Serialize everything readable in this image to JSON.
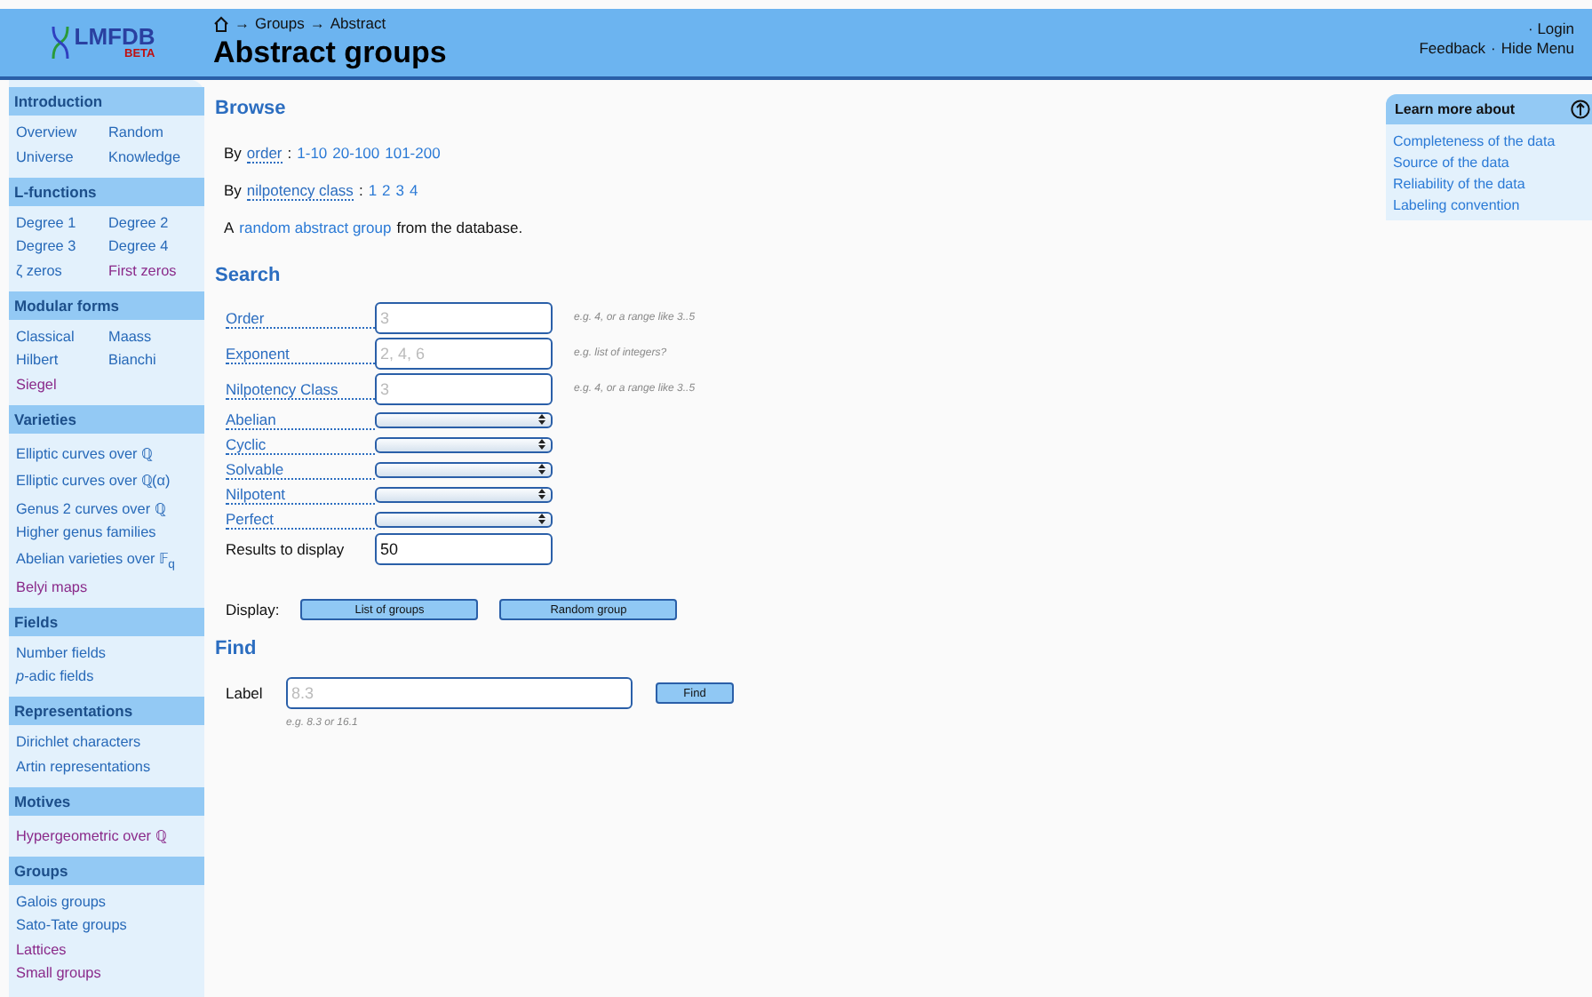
{
  "header": {
    "logo": {
      "text": "LMFDB",
      "badge": "BETA"
    },
    "breadcrumb": [
      {
        "separator": "→",
        "label": "Groups"
      },
      {
        "separator": "→",
        "label": "Abstract"
      }
    ],
    "title": "Abstract groups",
    "account_link": "· Login",
    "links": [
      "Feedback",
      "Hide Menu"
    ],
    "links_separator": "·"
  },
  "sidebar": [
    {
      "heading": "Introduction",
      "kind": "grid",
      "items": [
        {
          "label": "Overview",
          "visited": false
        },
        {
          "label": "Random",
          "visited": false
        },
        {
          "label": "Universe",
          "visited": false
        },
        {
          "label": "Knowledge",
          "visited": false
        }
      ]
    },
    {
      "heading": "L-functions",
      "kind": "grid",
      "items": [
        {
          "label": "Degree 1",
          "visited": false
        },
        {
          "label": "Degree 2",
          "visited": false
        },
        {
          "label": "Degree 3",
          "visited": false
        },
        {
          "label": "Degree 4",
          "visited": false
        },
        {
          "label": "ζ zeros",
          "visited": false
        },
        {
          "label": "First zeros",
          "visited": true
        }
      ]
    },
    {
      "heading": "Modular forms",
      "kind": "grid",
      "items": [
        {
          "label": "Classical",
          "visited": false
        },
        {
          "label": "Maass",
          "visited": false
        },
        {
          "label": "Hilbert",
          "visited": false
        },
        {
          "label": "Bianchi",
          "visited": false
        },
        {
          "label": "Siegel",
          "visited": true
        }
      ]
    },
    {
      "heading": "Varieties",
      "kind": "list",
      "items": [
        {
          "label": "Elliptic curves over ℚ",
          "visited": false
        },
        {
          "label": "Elliptic curves over ℚ(α)",
          "visited": false
        },
        {
          "label": "Genus 2 curves over ℚ",
          "visited": false
        },
        {
          "label": "Higher genus families",
          "visited": false
        },
        {
          "label": "Abelian varieties over 𝔽$_{q}$",
          "visited": false
        },
        {
          "label": "Belyi maps",
          "visited": true
        }
      ]
    },
    {
      "heading": "Fields",
      "kind": "list",
      "items": [
        {
          "label": "Number fields",
          "visited": false
        },
        {
          "label": "*p*-adic fields",
          "visited": false
        }
      ]
    },
    {
      "heading": "Representations",
      "kind": "list",
      "items": [
        {
          "label": "Dirichlet characters",
          "visited": false
        },
        {
          "label": "Artin representations",
          "visited": false
        }
      ]
    },
    {
      "heading": "Motives",
      "kind": "list",
      "items": [
        {
          "label": "Hypergeometric over ℚ",
          "visited": true
        }
      ]
    },
    {
      "heading": "Groups",
      "kind": "list",
      "items": [
        {
          "label": "Galois groups",
          "visited": false
        },
        {
          "label": "Sato-Tate groups",
          "visited": false
        },
        {
          "label": "Lattices",
          "visited": true
        },
        {
          "label": "Small groups",
          "visited": true
        }
      ]
    }
  ],
  "browse": {
    "heading": "Browse",
    "lines": [
      {
        "kind": "links",
        "prefix": "By",
        "knowl": "order",
        "suffix": ":",
        "links": [
          "1-10",
          "20-100",
          "101-200"
        ]
      },
      {
        "kind": "links",
        "prefix": "By",
        "knowl": "nilpotency class",
        "suffix": ":",
        "links": [
          "1",
          "2",
          "3",
          "4"
        ]
      },
      {
        "kind": "sentence",
        "prefix": "A",
        "link": "random abstract group",
        "suffix": "from the database."
      }
    ]
  },
  "search": {
    "heading": "Search",
    "fields": [
      {
        "kind": "text",
        "label": "Order",
        "placeholder": "3",
        "hint": "e.g. 4, or a range like 3..5"
      },
      {
        "kind": "text",
        "label": "Exponent",
        "placeholder": "2, 4, 6",
        "hint": "e.g. list of integers?"
      },
      {
        "kind": "text",
        "label": "Nilpotency Class",
        "placeholder": "3",
        "hint": "e.g. 4, or a range like 3..5"
      },
      {
        "kind": "select",
        "label": "Abelian"
      },
      {
        "kind": "select",
        "label": "Cyclic"
      },
      {
        "kind": "select",
        "label": "Solvable"
      },
      {
        "kind": "select",
        "label": "Nilpotent"
      },
      {
        "kind": "select",
        "label": "Perfect"
      },
      {
        "kind": "value",
        "label": "Results to display",
        "value": "50"
      }
    ],
    "display_label": "Display:",
    "buttons": [
      "List of groups",
      "Random group"
    ]
  },
  "find": {
    "heading": "Find",
    "label": "Label",
    "placeholder": "8.3",
    "button": "Find",
    "hint": "e.g. 8.3 or 16.1"
  },
  "learn_more": {
    "title": "Learn more about",
    "links": [
      "Completeness of the data",
      "Source of the data",
      "Reliability of the data",
      "Labeling convention"
    ]
  }
}
